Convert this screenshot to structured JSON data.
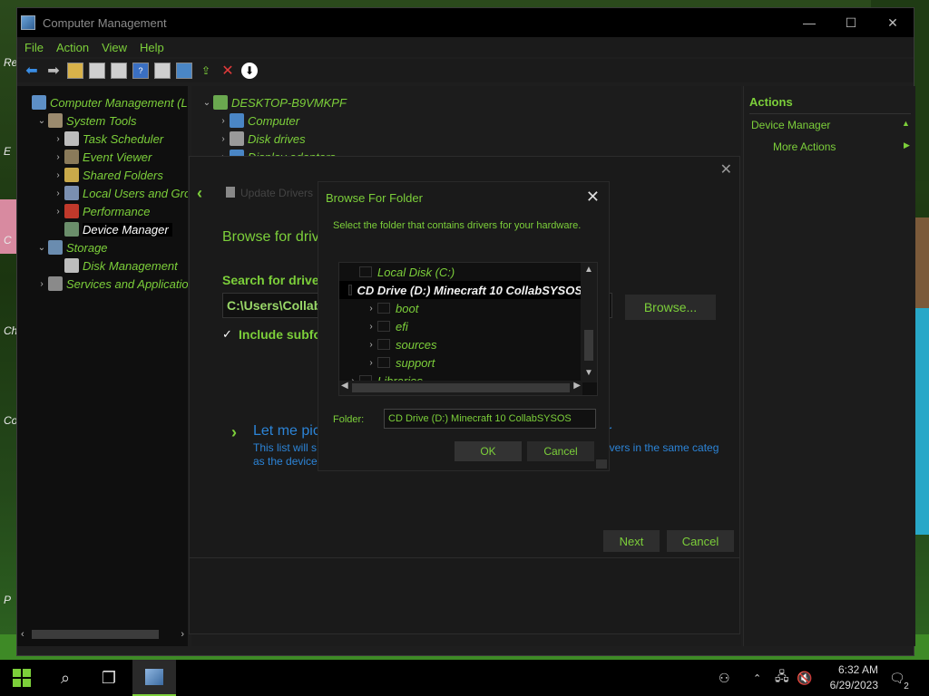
{
  "desktop": {
    "labels": [
      "Re",
      "E",
      "C",
      "Ch",
      "Co",
      "P"
    ]
  },
  "window": {
    "title": "Computer Management",
    "controls": {
      "minimize": "—",
      "maximize": "☐",
      "close": "✕"
    }
  },
  "menu": [
    "File",
    "Action",
    "View",
    "Help"
  ],
  "left_tree": [
    {
      "label": "Computer Management (Lo",
      "indent": 0,
      "chevron": "",
      "icon_color": "#5d8fc6"
    },
    {
      "label": "System Tools",
      "indent": 1,
      "chevron": "⌄",
      "icon_color": "#9b8a6e"
    },
    {
      "label": "Task Scheduler",
      "indent": 2,
      "chevron": "›",
      "icon_color": "#bdbdbd"
    },
    {
      "label": "Event Viewer",
      "indent": 2,
      "chevron": "›",
      "icon_color": "#8a7a5a"
    },
    {
      "label": "Shared Folders",
      "indent": 2,
      "chevron": "›",
      "icon_color": "#c9a94a"
    },
    {
      "label": "Local Users and Grou",
      "indent": 2,
      "chevron": "›",
      "icon_color": "#7a8fb0"
    },
    {
      "label": "Performance",
      "indent": 2,
      "chevron": "›",
      "icon_color": "#c0392b"
    },
    {
      "label": "Device Manager",
      "indent": 2,
      "chevron": "",
      "icon_color": "#6b8e6b",
      "selected": true
    },
    {
      "label": "Storage",
      "indent": 1,
      "chevron": "⌄",
      "icon_color": "#6a8caf"
    },
    {
      "label": "Disk Management",
      "indent": 2,
      "chevron": "",
      "icon_color": "#bdbdbd"
    },
    {
      "label": "Services and Applicatio",
      "indent": 1,
      "chevron": "›",
      "icon_color": "#8a8a8a"
    }
  ],
  "device_tree": [
    {
      "label": "DESKTOP-B9VMKPF",
      "indent": 0,
      "chevron": "⌄",
      "icon_color": "#6aa84f"
    },
    {
      "label": "Computer",
      "indent": 1,
      "chevron": "›",
      "icon_color": "#4a86c5"
    },
    {
      "label": "Disk drives",
      "indent": 1,
      "chevron": "›",
      "icon_color": "#9a9a9a"
    },
    {
      "label": "Display adapters",
      "indent": 1,
      "chevron": "›",
      "icon_color": "#4a86c5"
    }
  ],
  "actions": {
    "header": "Actions",
    "section": "Device Manager",
    "more": "More Actions"
  },
  "update_dialog": {
    "title": "Update Drivers",
    "heading": "Browse for drive",
    "search_label": "Search for driver",
    "path_value": "C:\\Users\\Collab",
    "browse_button": "Browse...",
    "include_subfolders": "Include subfol",
    "pick_link": "Let me pic",
    "pick_link_tail": "r",
    "pick_desc_line1": "This list will s",
    "pick_desc_line2": "as the device.",
    "pick_desc_tail": "ivers in the same categ",
    "next_button": "Next",
    "cancel_button": "Cancel"
  },
  "browse_dialog": {
    "title": "Browse For Folder",
    "instruction": "Select the folder that contains drivers for your hardware.",
    "tree": [
      {
        "label": "Local Disk (C:)",
        "indent": 0,
        "chevron": ""
      },
      {
        "label": "CD Drive (D:) Minecraft 10 CollabSYSOS",
        "indent": 0,
        "chevron": "",
        "selected": true
      },
      {
        "label": "boot",
        "indent": 1,
        "chevron": "›"
      },
      {
        "label": "efi",
        "indent": 1,
        "chevron": "›"
      },
      {
        "label": "sources",
        "indent": 1,
        "chevron": "›"
      },
      {
        "label": "support",
        "indent": 1,
        "chevron": "›"
      },
      {
        "label": "Libraries",
        "indent": 0,
        "chevron": "›"
      }
    ],
    "folder_label": "Folder:",
    "folder_value": "CD Drive (D:) Minecraft 10 CollabSYSOS",
    "ok_button": "OK",
    "cancel_button": "Cancel"
  },
  "taskbar": {
    "time": "6:32 AM",
    "date": "6/29/2023",
    "notification_count": "2"
  },
  "colors": {
    "accent": "#7ccf3a",
    "link": "#2c84d7",
    "background": "#1c1c1c"
  }
}
